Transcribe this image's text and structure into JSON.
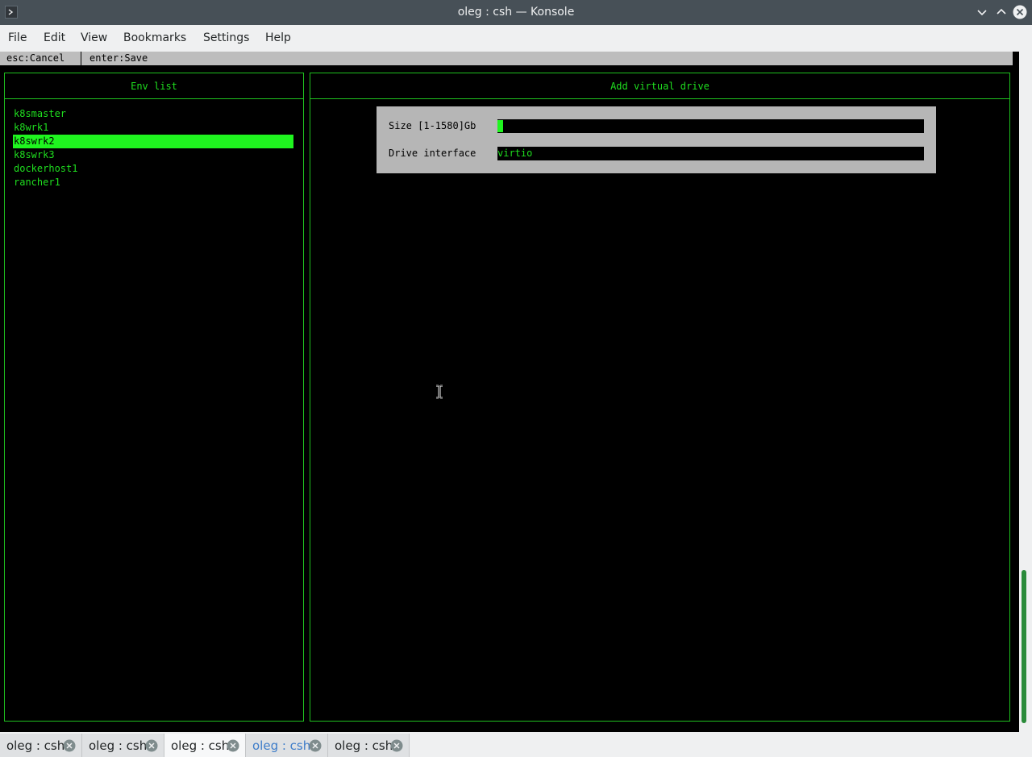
{
  "window": {
    "title": "oleg : csh — Konsole",
    "icons": [
      "terminal-icon",
      "chevron-down-icon",
      "chevron-up-icon",
      "close-icon"
    ]
  },
  "menu": [
    "File",
    "Edit",
    "View",
    "Bookmarks",
    "Settings",
    "Help"
  ],
  "keybar": {
    "cancel": "esc:Cancel",
    "save": "enter:Save"
  },
  "env_panel": {
    "title": "Env list",
    "items": [
      "k8smaster",
      "k8wrk1",
      "k8swrk2",
      "k8swrk3",
      "dockerhost1",
      "rancher1"
    ],
    "selected": "k8swrk2"
  },
  "drive_panel": {
    "title": "Add virtual drive",
    "size_label": "Size [1-1580]Gb",
    "size_value": "",
    "interface_label": "Drive interface",
    "interface_value": "virtio"
  },
  "tabs": [
    {
      "label": "oleg : csh",
      "state": "normal"
    },
    {
      "label": "oleg : csh",
      "state": "normal"
    },
    {
      "label": "oleg : csh",
      "state": "active"
    },
    {
      "label": "oleg : csh",
      "state": "highlight"
    },
    {
      "label": "oleg : csh",
      "state": "normal"
    }
  ],
  "colors": {
    "terminal_green": "#1fdf1f",
    "selection_green": "#1ff51f",
    "dialog_gray": "#b6b6b6",
    "titlebar": "#475057"
  }
}
